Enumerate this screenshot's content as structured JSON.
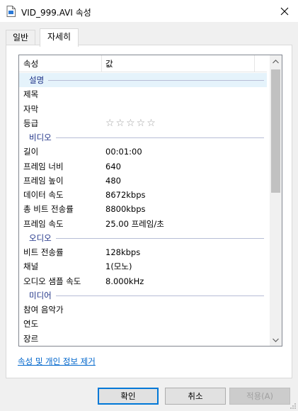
{
  "window": {
    "title": "VID_999.AVI 속성",
    "close_icon": "close-icon",
    "file_icon": "document-icon"
  },
  "tabs": [
    {
      "label": "일반",
      "active": false
    },
    {
      "label": "자세히",
      "active": true
    }
  ],
  "list": {
    "headers": {
      "property": "속성",
      "value": "값"
    },
    "groups": [
      {
        "name": "설명",
        "rows": [
          {
            "label": "제목",
            "value": ""
          },
          {
            "label": "자막",
            "value": ""
          },
          {
            "label": "등급",
            "value": "",
            "stars": "☆☆☆☆☆"
          }
        ]
      },
      {
        "name": "비디오",
        "rows": [
          {
            "label": "길이",
            "value": "00:01:00"
          },
          {
            "label": "프레임 너비",
            "value": "640"
          },
          {
            "label": "프레임 높이",
            "value": "480"
          },
          {
            "label": "데이터 속도",
            "value": "8672kbps"
          },
          {
            "label": "총 비트 전송률",
            "value": "8800kbps"
          },
          {
            "label": "프레임 속도",
            "value": "25.00 프레임/초"
          }
        ]
      },
      {
        "name": "오디오",
        "rows": [
          {
            "label": "비트 전송률",
            "value": "128kbps"
          },
          {
            "label": "채널",
            "value": "1(모노)"
          },
          {
            "label": "오디오 샘플 속도",
            "value": "8.000kHz"
          }
        ]
      },
      {
        "name": "미디어",
        "rows": [
          {
            "label": "참여 음악가",
            "value": ""
          },
          {
            "label": "연도",
            "value": ""
          },
          {
            "label": "장르",
            "value": ""
          }
        ]
      }
    ]
  },
  "remove_link": "속성 및 개인 정보 제거",
  "buttons": {
    "ok": "확인",
    "cancel": "취소",
    "apply": "적용(A)"
  },
  "colors": {
    "group_text": "#1e3287",
    "link": "#0066cc",
    "accent": "#0078d7",
    "selection": "#e5f3fb"
  }
}
